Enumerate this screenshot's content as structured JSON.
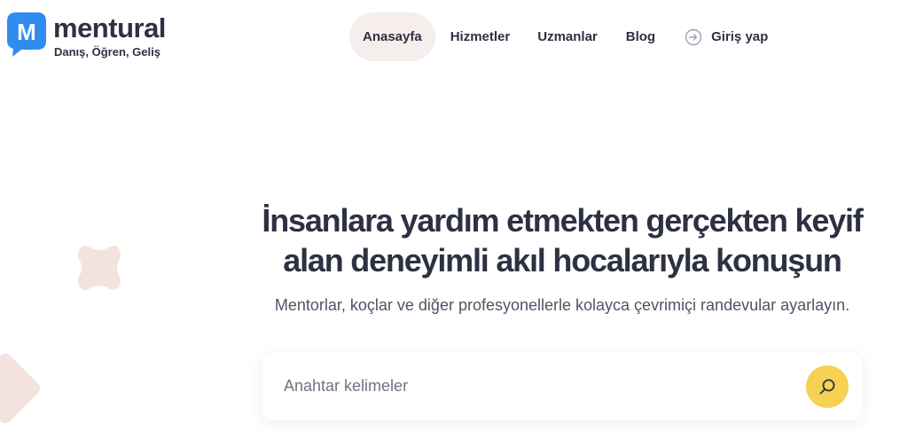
{
  "brand": {
    "name": "mentural",
    "tagline": "Danış, Öğren, Geliş",
    "logo_letter": "M",
    "primary_color": "#2f8cf0",
    "text_color": "#2d3142"
  },
  "nav": {
    "items": [
      {
        "label": "Anasayfa",
        "active": true
      },
      {
        "label": "Hizmetler"
      },
      {
        "label": "Uzmanlar"
      },
      {
        "label": "Blog"
      }
    ],
    "login": {
      "label": "Giriş yap",
      "icon": "login-arrow-icon"
    },
    "active_bg": "#f5eeec"
  },
  "hero": {
    "title_line1": "İnsanlara yardım etmekten gerçekten keyif",
    "title_line2": "alan deneyimli akıl hocalarıyla konuşun",
    "subtitle": "Mentorlar, koçlar ve diğer profesyonellerle kolayca çevrimiçi randevular ayarlayın."
  },
  "search": {
    "value": "",
    "placeholder": "Anahtar kelimeler",
    "button_icon": "search-icon",
    "button_color": "#f7d154"
  },
  "decorations": {
    "accent_color": "#f3e2dd"
  }
}
